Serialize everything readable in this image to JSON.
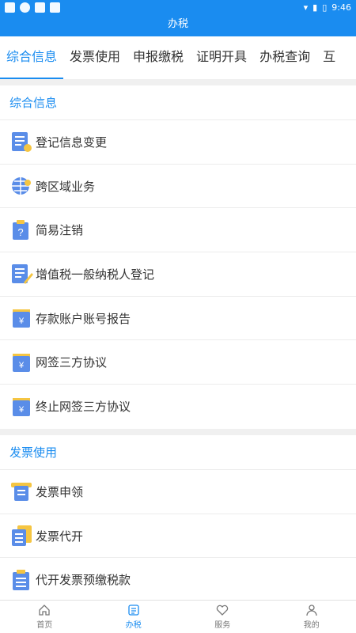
{
  "status": {
    "time": "9:46"
  },
  "title": "办税",
  "tabs": [
    {
      "label": "综合信息"
    },
    {
      "label": "发票使用"
    },
    {
      "label": "申报缴税"
    },
    {
      "label": "证明开具"
    },
    {
      "label": "办税查询"
    },
    {
      "label": "互"
    }
  ],
  "sections": [
    {
      "title": "综合信息",
      "items": [
        {
          "label": "登记信息变更",
          "icon": "doc-edit-icon"
        },
        {
          "label": "跨区域业务",
          "icon": "globe-icon"
        },
        {
          "label": "简易注销",
          "icon": "clipboard-question-icon"
        },
        {
          "label": "增值税一般纳税人登记",
          "icon": "doc-pen-icon"
        },
        {
          "label": "存款账户账号报告",
          "icon": "yen-doc-icon"
        },
        {
          "label": "网签三方协议",
          "icon": "yen-doc-icon"
        },
        {
          "label": "终止网签三方协议",
          "icon": "yen-doc-icon"
        }
      ]
    },
    {
      "title": "发票使用",
      "items": [
        {
          "label": "发票申领",
          "icon": "invoice-apply-icon"
        },
        {
          "label": "发票代开",
          "icon": "invoice-issue-icon"
        },
        {
          "label": "代开发票预缴税款",
          "icon": "clipboard-icon"
        }
      ]
    }
  ],
  "nav": [
    {
      "label": "首页",
      "icon": "home-icon"
    },
    {
      "label": "办税",
      "icon": "list-icon"
    },
    {
      "label": "服务",
      "icon": "heart-icon"
    },
    {
      "label": "我的",
      "icon": "user-icon"
    }
  ],
  "colors": {
    "primary": "#1a8cf0",
    "accent": "#f5c542"
  }
}
